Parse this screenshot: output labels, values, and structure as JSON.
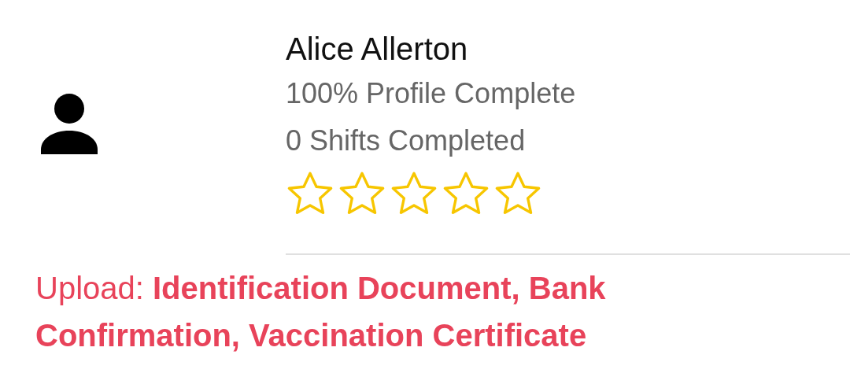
{
  "profile": {
    "name": "Alice Allerton",
    "completion": "100% Profile Complete",
    "shifts": "0 Shifts Completed",
    "stars": 0
  },
  "upload": {
    "text": "Upload: **Identification Document, Bank Confirmation, Vaccination Certificate**"
  }
}
